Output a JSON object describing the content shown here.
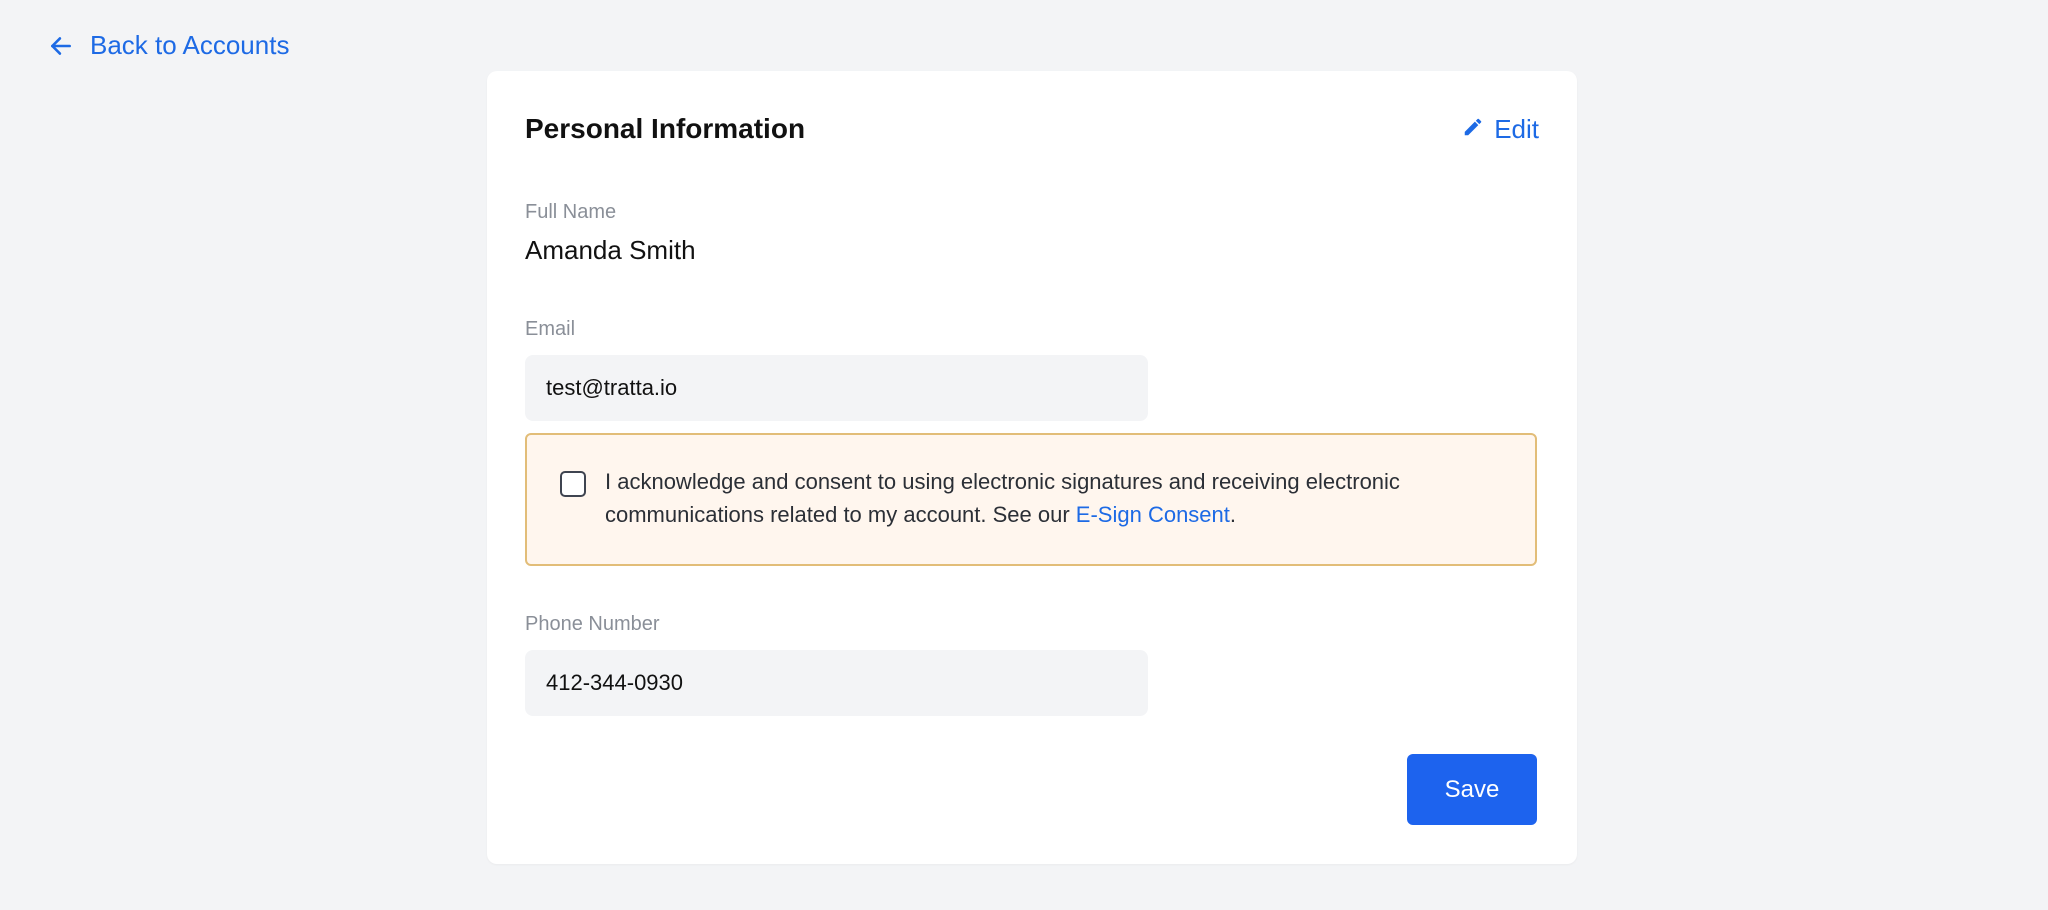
{
  "nav": {
    "back_label": "Back to Accounts",
    "back_icon": "arrow-left-icon"
  },
  "card": {
    "title": "Personal Information",
    "edit_label": "Edit",
    "edit_icon": "pencil-icon"
  },
  "fields": {
    "full_name": {
      "label": "Full Name",
      "value": "Amanda Smith"
    },
    "email": {
      "label": "Email",
      "value": "test@tratta.io"
    },
    "phone": {
      "label": "Phone Number",
      "value": "412-344-0930"
    }
  },
  "consent": {
    "checked": false,
    "text": "I acknowledge and consent to using electronic signatures and receiving electronic communications related to my account. See our ",
    "link_label": "E-Sign Consent",
    "suffix": "."
  },
  "actions": {
    "save_label": "Save"
  },
  "colors": {
    "accent": "#1d6ae5",
    "button": "#1d63ee",
    "page_background": "#f3f4f6",
    "consent_background": "#fff6ee",
    "consent_border": "#e2bd78"
  }
}
